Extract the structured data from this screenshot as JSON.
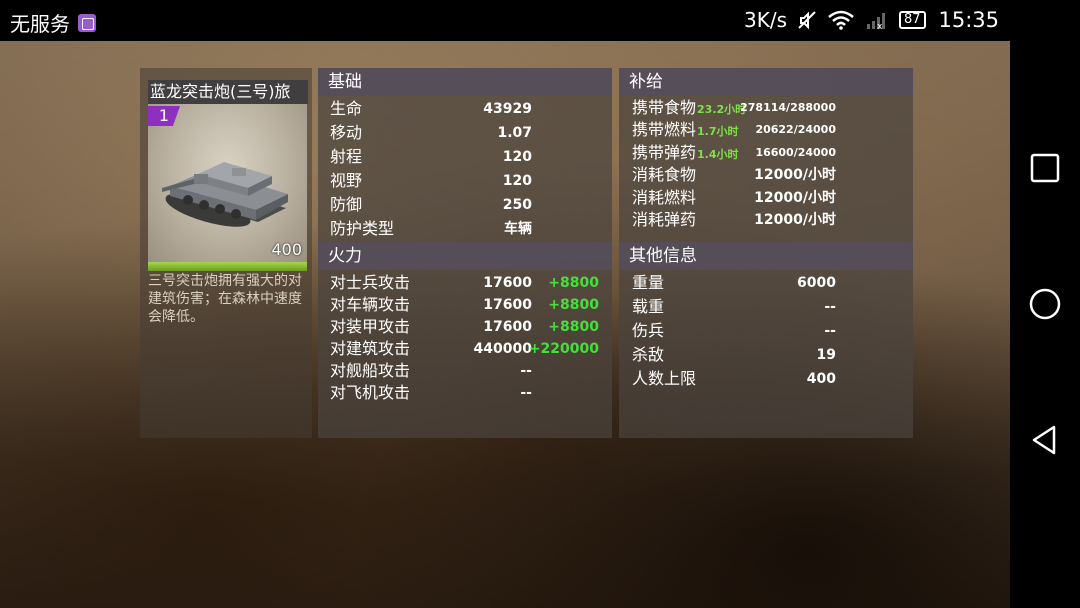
{
  "status_bar": {
    "carrier": "无服务",
    "speed": "3K/s",
    "battery": "87",
    "time": "15:35"
  },
  "unit": {
    "name": "蓝龙突击炮(三号)旅",
    "level": "1",
    "count": "400",
    "health_fraction": 1.0,
    "description": "三号突击炮拥有强大的对建筑伤害；在森林中速度会降低。"
  },
  "basic": {
    "title": "基础",
    "rows": [
      {
        "label": "生命",
        "value": "43929"
      },
      {
        "label": "移动",
        "value": "1.07"
      },
      {
        "label": "射程",
        "value": "120"
      },
      {
        "label": "视野",
        "value": "120"
      },
      {
        "label": "防御",
        "value": "250"
      },
      {
        "label": "防护类型",
        "value": "车辆"
      }
    ]
  },
  "firepower": {
    "title": "火力",
    "rows": [
      {
        "label": "对士兵攻击",
        "value": "17600",
        "bonus": "+8800"
      },
      {
        "label": "对车辆攻击",
        "value": "17600",
        "bonus": "+8800"
      },
      {
        "label": "对装甲攻击",
        "value": "17600",
        "bonus": "+8800"
      },
      {
        "label": "对建筑攻击",
        "value": "440000",
        "bonus": "+220000"
      },
      {
        "label": "对舰船攻击",
        "value": "--",
        "bonus": ""
      },
      {
        "label": "对飞机攻击",
        "value": "--",
        "bonus": ""
      }
    ]
  },
  "supply": {
    "title": "补给",
    "rows": [
      {
        "label": "携带食物",
        "rate": "23.2小时",
        "value": "278114/288000"
      },
      {
        "label": "携带燃料",
        "rate": "1.7小时",
        "value": "20622/24000"
      },
      {
        "label": "携带弹药",
        "rate": "1.4小时",
        "value": "16600/24000"
      },
      {
        "label": "消耗食物",
        "rate": "",
        "value": "12000/小时"
      },
      {
        "label": "消耗燃料",
        "rate": "",
        "value": "12000/小时"
      },
      {
        "label": "消耗弹药",
        "rate": "",
        "value": "12000/小时"
      }
    ]
  },
  "other": {
    "title": "其他信息",
    "rows": [
      {
        "label": "重量",
        "value": "6000"
      },
      {
        "label": "载重",
        "value": "--"
      },
      {
        "label": "伤兵",
        "value": "--"
      },
      {
        "label": "杀敌",
        "value": "19"
      },
      {
        "label": "人数上限",
        "value": "400"
      }
    ]
  },
  "colors": {
    "level_badge": "#8e2fbf",
    "bonus": "#44e03a",
    "health_bar": "#8cc63a"
  },
  "icons": [
    "app-notification-icon",
    "mute-icon",
    "wifi-icon",
    "signal-icon",
    "battery-icon",
    "recent-apps-icon",
    "home-icon",
    "back-icon"
  ]
}
